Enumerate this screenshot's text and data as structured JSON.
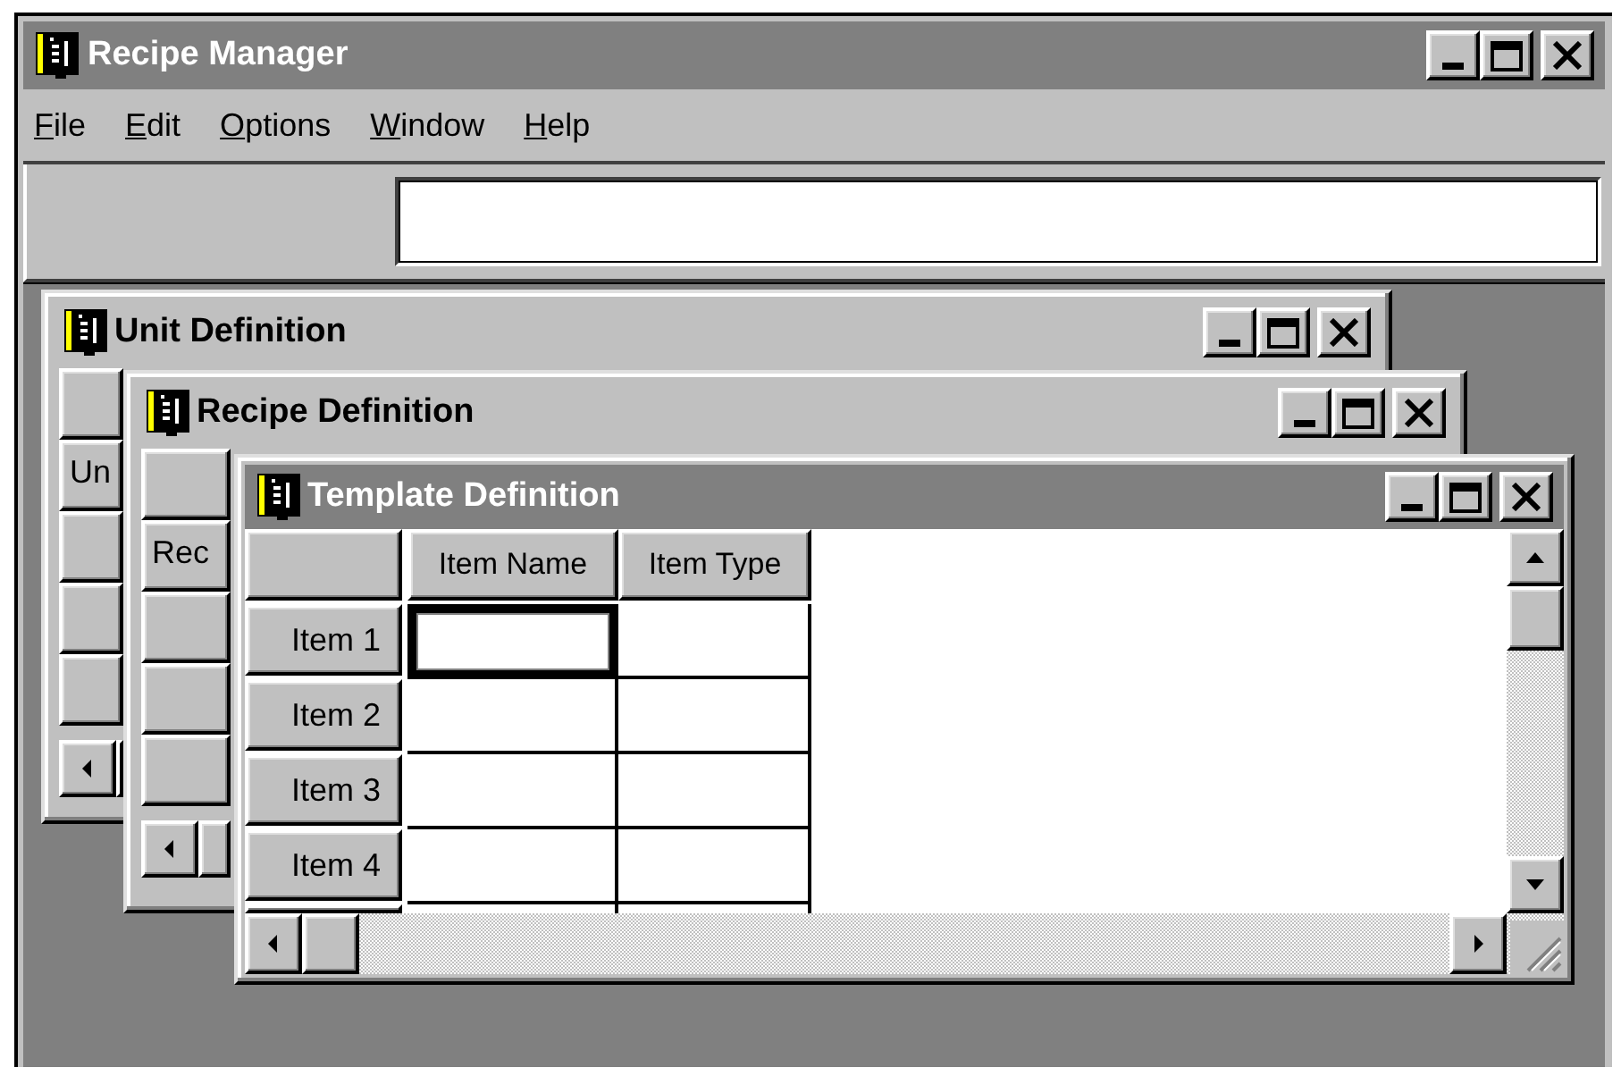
{
  "window": {
    "title": "Recipe Manager",
    "active": true
  },
  "menu": [
    {
      "key": "F",
      "rest": "ile"
    },
    {
      "key": "E",
      "rest": "dit"
    },
    {
      "key": "O",
      "rest": "ptions"
    },
    {
      "key": "W",
      "rest": "indow"
    },
    {
      "key": "H",
      "rest": "elp"
    }
  ],
  "child_windows": [
    {
      "kind": "list",
      "title": "Unit Definition",
      "active": false,
      "header_text": "Un"
    },
    {
      "kind": "list",
      "title": "Recipe Definition",
      "active": false,
      "header_text": "Rec"
    },
    {
      "kind": "grid",
      "title": "Template Definition",
      "active": true,
      "grid": {
        "columns": [
          "Item Name",
          "Item Type"
        ],
        "rows": [
          {
            "label": "Item 1",
            "cells": [
              {
                "focused": true
              },
              {
                "focused": false
              }
            ]
          },
          {
            "label": "Item 2",
            "cells": [
              {
                "focused": false
              },
              {
                "focused": false
              }
            ]
          },
          {
            "label": "Item 3",
            "cells": [
              {
                "focused": false
              },
              {
                "focused": false
              }
            ]
          },
          {
            "label": "Item 4",
            "cells": [
              {
                "focused": false
              },
              {
                "focused": false
              }
            ]
          }
        ]
      }
    }
  ]
}
